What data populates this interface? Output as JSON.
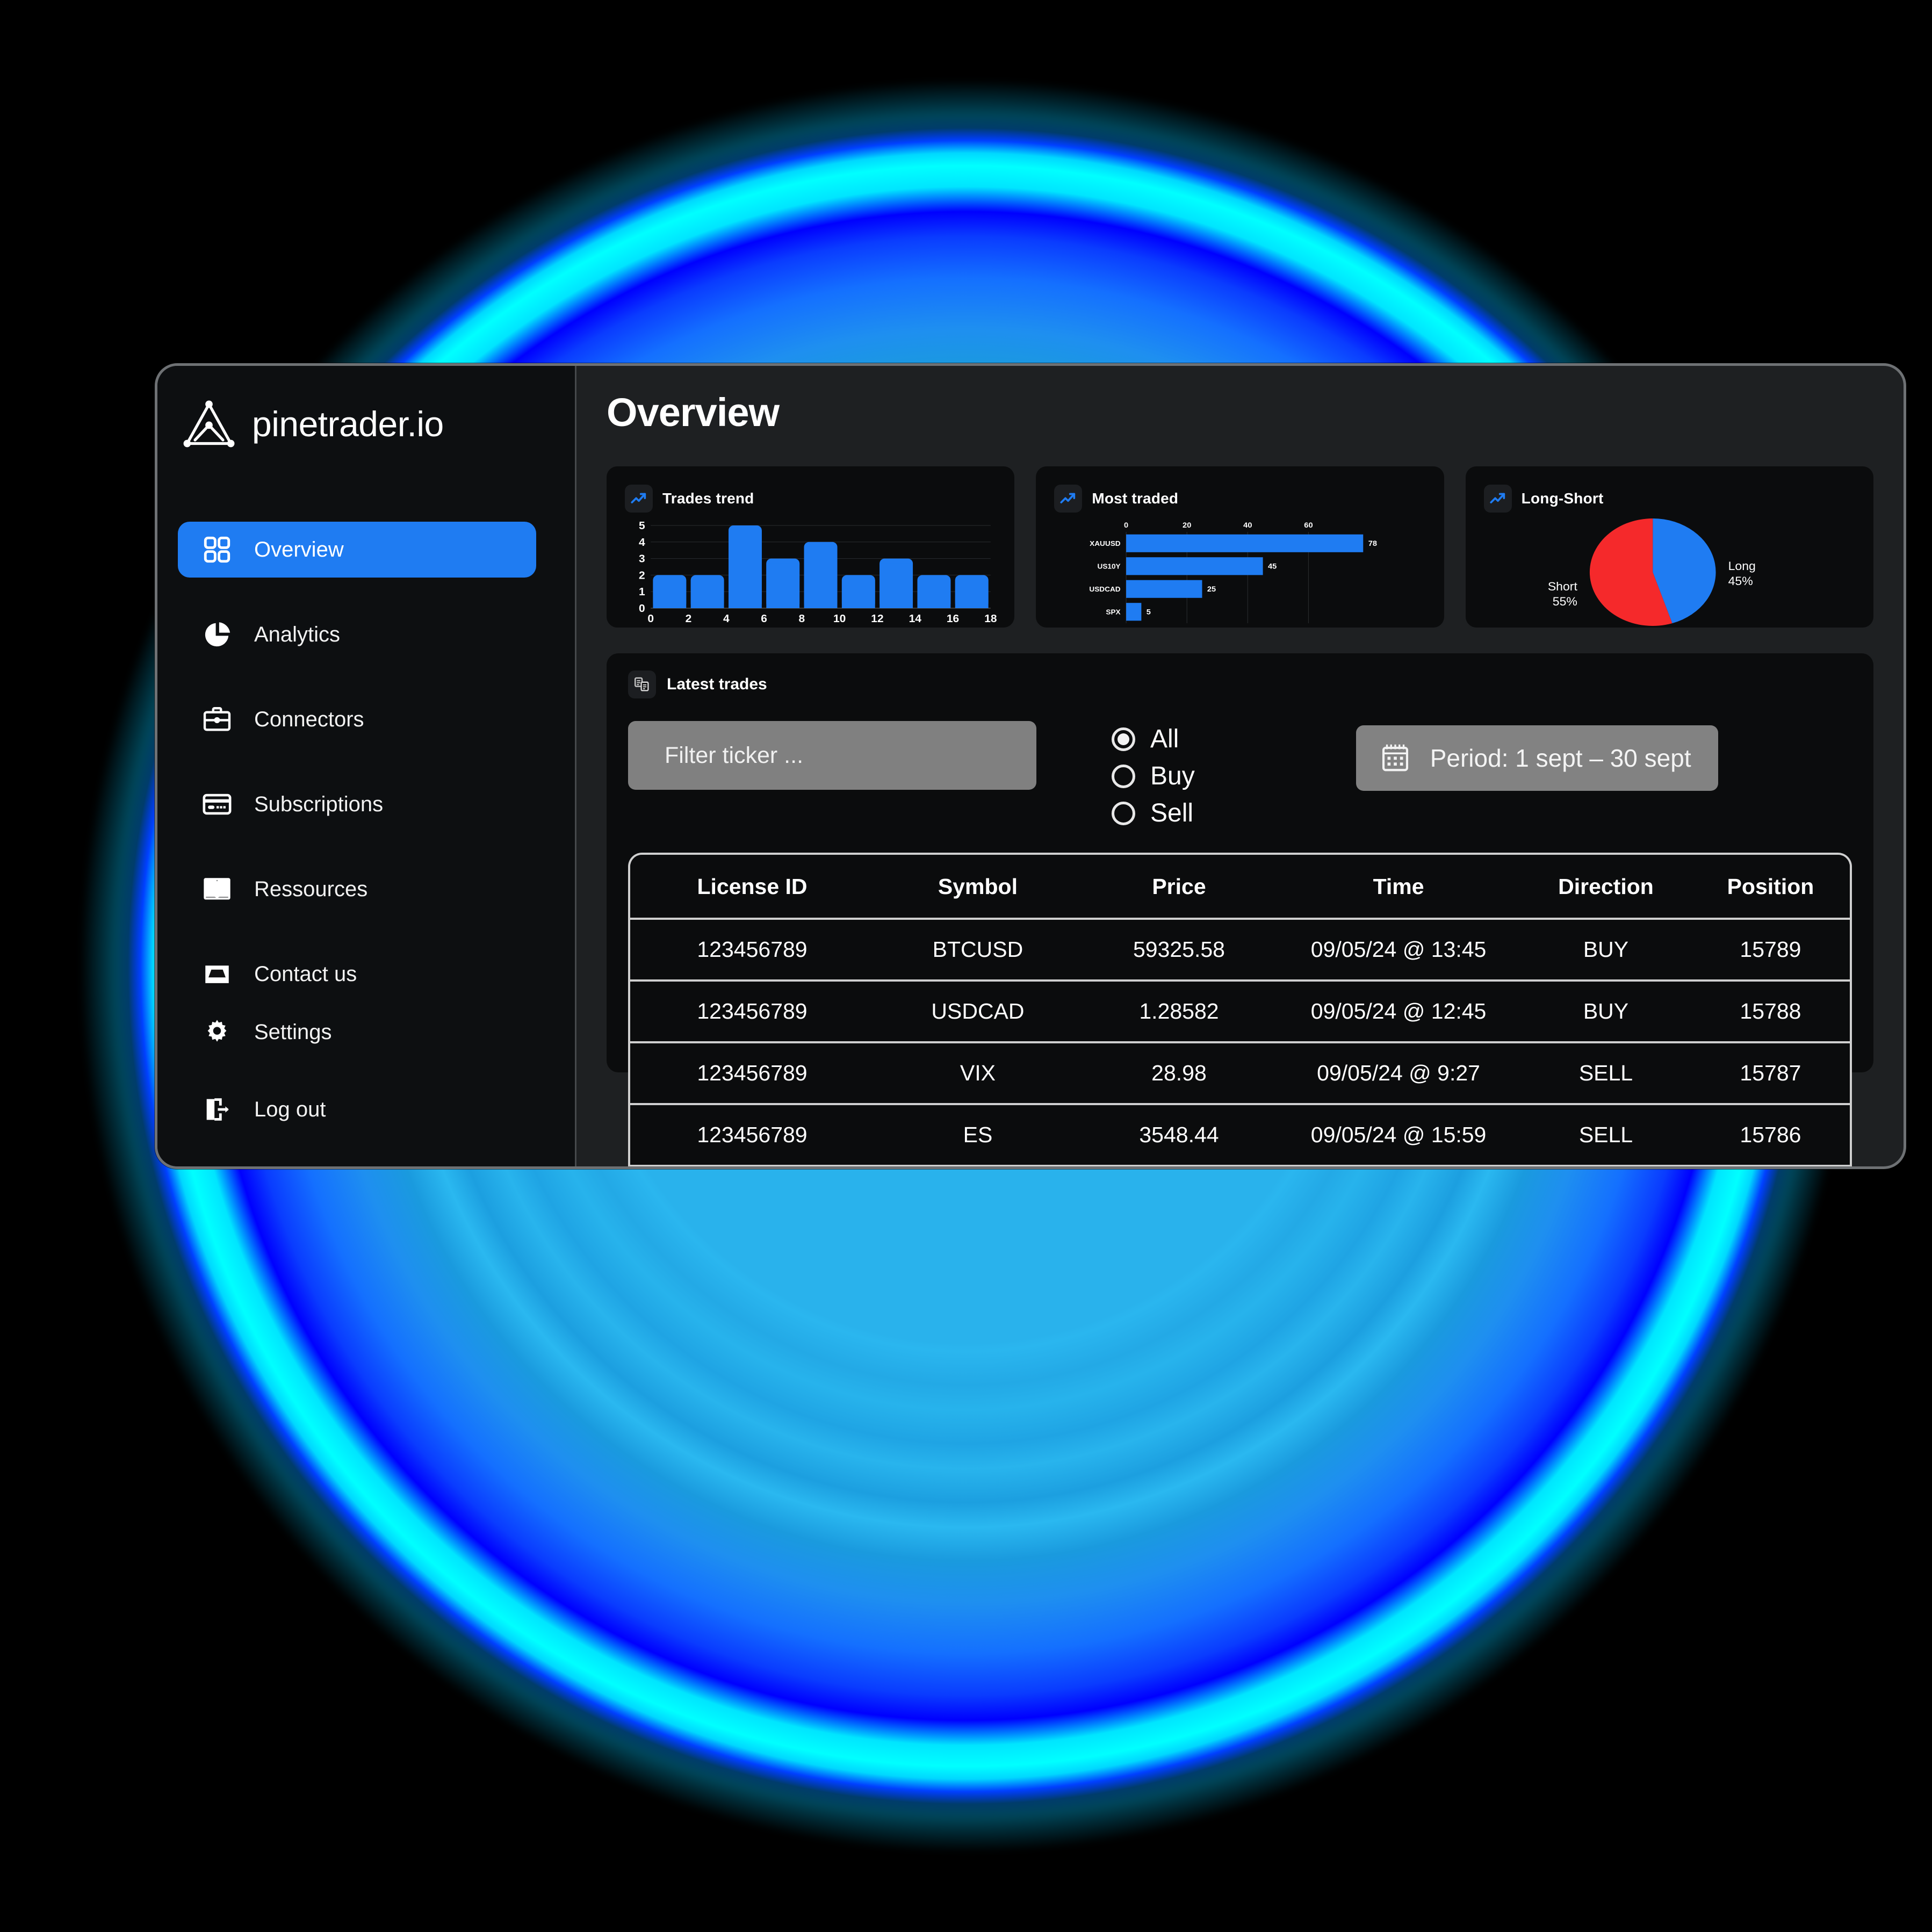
{
  "brand": {
    "name": "pinetrader.io",
    "logo_icon": "triangle-peak-logo"
  },
  "sidebar": {
    "items": [
      {
        "label": "Overview",
        "icon": "grid-icon",
        "active": true
      },
      {
        "label": "Analytics",
        "icon": "pie-chart-icon",
        "active": false
      },
      {
        "label": "Connectors",
        "icon": "briefcase-icon",
        "active": false
      },
      {
        "label": "Subscriptions",
        "icon": "credit-card-icon",
        "active": false
      },
      {
        "label": "Ressources",
        "icon": "open-book-icon",
        "active": false
      },
      {
        "label": "Contact us",
        "icon": "inbox-icon",
        "active": false
      }
    ],
    "bottom_items": [
      {
        "label": "Settings",
        "icon": "gear-icon"
      },
      {
        "label": "Log out",
        "icon": "logout-icon"
      }
    ]
  },
  "header": {
    "title": "Overview"
  },
  "cards": [
    {
      "title": "Trades trend",
      "icon": "trend-up-icon"
    },
    {
      "title": "Most traded",
      "icon": "trend-up-icon"
    },
    {
      "title": "Long-Short",
      "icon": "trend-up-icon"
    }
  ],
  "trades_panel": {
    "title": "Latest trades",
    "icon": "list-grid-icon",
    "filter": {
      "placeholder": "Filter ticker ...",
      "value": ""
    },
    "radio_options": [
      {
        "label": "All",
        "checked": true
      },
      {
        "label": "Buy",
        "checked": false
      },
      {
        "label": "Sell",
        "checked": false
      }
    ],
    "period_button": {
      "label": "Period: 1 sept – 30 sept",
      "icon": "calendar-icon"
    },
    "table": {
      "columns": [
        "License ID",
        "Symbol",
        "Price",
        "Time",
        "Direction",
        "Position"
      ],
      "rows": [
        {
          "license": "123456789",
          "symbol": "BTCUSD",
          "price": "59325.58",
          "time": "09/05/24 @ 13:45",
          "direction": "BUY",
          "position": "15789"
        },
        {
          "license": "123456789",
          "symbol": "USDCAD",
          "price": "1.28582",
          "time": "09/05/24 @ 12:45",
          "direction": "BUY",
          "position": "15788"
        },
        {
          "license": "123456789",
          "symbol": "VIX",
          "price": "28.98",
          "time": "09/05/24 @ 9:27",
          "direction": "SELL",
          "position": "15787"
        },
        {
          "license": "123456789",
          "symbol": "ES",
          "price": "3548.44",
          "time": "09/05/24 @ 15:59",
          "direction": "SELL",
          "position": "15786"
        }
      ]
    }
  },
  "colors": {
    "accent_blue": "#1f7cf2",
    "sell_red": "#f01f1f",
    "card_bg": "#0b0c0d",
    "sidebar_bg": "#0d0f11",
    "main_bg": "#1e2022",
    "glow_cyan": "#00ffff",
    "glow_blue": "#0000ff"
  },
  "chart_data": [
    {
      "type": "bar",
      "title": "Trades trend",
      "x": [
        1,
        3,
        5,
        7,
        9,
        11,
        13,
        15,
        17
      ],
      "values": [
        2,
        2,
        5,
        3,
        4,
        2,
        3,
        2,
        2
      ],
      "xlabel": "",
      "ylabel": "",
      "xticks": [
        0,
        2,
        4,
        6,
        8,
        10,
        12,
        14,
        16,
        18
      ],
      "yticks": [
        0,
        1,
        2,
        3,
        4,
        5
      ],
      "xlim": [
        0,
        18
      ],
      "ylim": [
        0,
        5
      ],
      "grid": true,
      "series_color": "#1f7cf2"
    },
    {
      "type": "bar",
      "orientation": "horizontal",
      "title": "Most traded",
      "categories": [
        "XAUUSD",
        "US10Y",
        "USDCAD",
        "SPX"
      ],
      "values": [
        78,
        45,
        25,
        5
      ],
      "data_labels": [
        "78",
        "45",
        "25",
        "5"
      ],
      "xticks": [
        0,
        20,
        40,
        60
      ],
      "xlim": [
        0,
        80
      ],
      "grid": true,
      "series_color": "#1f7cf2"
    },
    {
      "type": "pie",
      "title": "Long-Short",
      "labels": [
        "Long",
        "Short"
      ],
      "values": [
        45,
        55
      ],
      "value_labels": [
        "45%",
        "55%"
      ],
      "colors": [
        "#1f7cf2",
        "#f5292b"
      ],
      "legend": "outside-labels"
    }
  ]
}
